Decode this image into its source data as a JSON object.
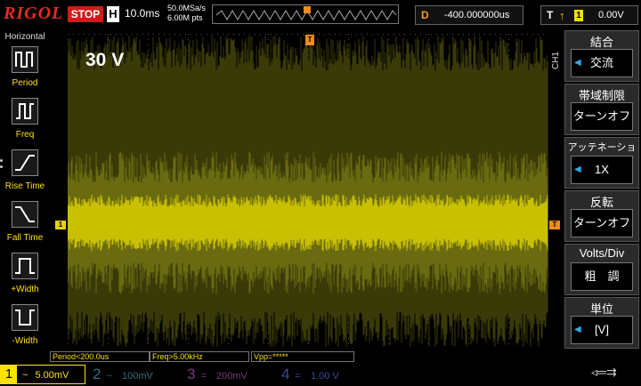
{
  "header": {
    "brand": "RIGOL",
    "run_state": "STOP",
    "horizontal_key": "H",
    "timebase": "10.0ms",
    "sample_rate": "50.0MSa/s",
    "memory_depth": "6.00M pts",
    "delay_key": "D",
    "delay_value": "-400.000000us",
    "trigger_key": "T",
    "trigger_source": "1",
    "trigger_level": "0.00V"
  },
  "left_panel": {
    "title": "Horizontal",
    "items": [
      {
        "label": "Period",
        "icon": "period-icon"
      },
      {
        "label": "Freq",
        "icon": "freq-icon"
      },
      {
        "label": "Rise Time",
        "icon": "rise-time-icon"
      },
      {
        "label": "Fall Time",
        "icon": "fall-time-icon"
      },
      {
        "label": "+Width",
        "icon": "positive-width-icon"
      },
      {
        "label": "-Width",
        "icon": "negative-width-icon"
      }
    ]
  },
  "waveform": {
    "overlay_label": "30 V",
    "ch1_marker": "1",
    "trigger_marker": "T",
    "trace_color": "#c8c000",
    "grid_color": "#4a4a1a"
  },
  "measurements": [
    "Period<200.0us",
    "Freq>5.00kHz",
    "Vpp=*****"
  ],
  "channels": [
    {
      "num": "1",
      "coupling": "~",
      "scale": "5.00mV",
      "color": "#ffe100",
      "active": true
    },
    {
      "num": "2",
      "coupling": "~",
      "scale": "100mV",
      "color": "#3a6a7a",
      "active": false
    },
    {
      "num": "3",
      "coupling": "=",
      "scale": "200mV",
      "color": "#7a3a7a",
      "active": false
    },
    {
      "num": "4",
      "coupling": "=",
      "scale": "1.00 V",
      "color": "#3a4a9a",
      "active": false
    }
  ],
  "right_menu": {
    "side_label": "CH1",
    "items": [
      {
        "title": "結合",
        "value": "交流"
      },
      {
        "title": "帯域制限",
        "value": "ターンオフ"
      },
      {
        "title": "アッテネーション",
        "value": "1X"
      },
      {
        "title": "反転",
        "value": "ターンオフ"
      },
      {
        "title": "Volts/Div",
        "value": "粗　調"
      },
      {
        "title": "単位",
        "value": "[V]"
      }
    ]
  }
}
